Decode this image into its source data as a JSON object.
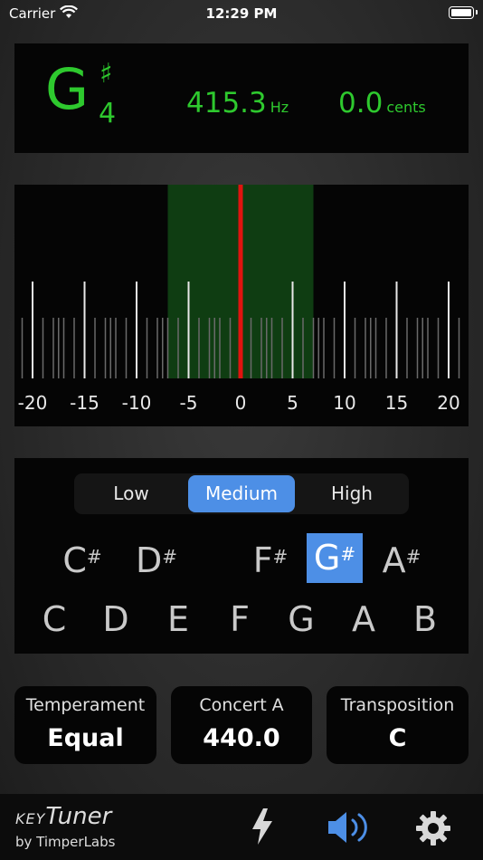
{
  "status_bar": {
    "carrier": "Carrier",
    "time": "12:29 PM"
  },
  "note": {
    "letter": "G",
    "accidental": "♯",
    "octave": "4",
    "frequency": "415.3",
    "frequency_unit": "Hz",
    "cents": "0.0",
    "cents_unit": "cents",
    "color": "#2ec92e"
  },
  "meter": {
    "ticks": [
      "-20",
      "-15",
      "-10",
      "-5",
      "0",
      "5",
      "10",
      "15",
      "20"
    ],
    "needle_cents": 0.0,
    "in_tune_band_color": "#0f3d12",
    "needle_color": "#e0130f"
  },
  "range_selector": {
    "options": [
      "Low",
      "Medium",
      "High"
    ],
    "selected": "Medium"
  },
  "keys": {
    "sharps": [
      {
        "letter": "C",
        "sym": "#"
      },
      {
        "letter": "D",
        "sym": "#"
      },
      {
        "letter": "F",
        "sym": "#"
      },
      {
        "letter": "G",
        "sym": "#"
      },
      {
        "letter": "A",
        "sym": "#"
      }
    ],
    "naturals": [
      "C",
      "D",
      "E",
      "F",
      "G",
      "A",
      "B"
    ],
    "selected": "G#",
    "accent": "#4d8fe6"
  },
  "settings": {
    "temperament": {
      "label": "Temperament",
      "value": "Equal"
    },
    "concert_a": {
      "label": "Concert A",
      "value": "440.0"
    },
    "transposition": {
      "label": "Transposition",
      "value": "C"
    }
  },
  "branding": {
    "key": "KEY",
    "tuner": "Tuner",
    "byline": "by TimperLabs"
  },
  "toolbar": {
    "icons": [
      "lightning-icon",
      "speaker-icon",
      "gear-icon"
    ]
  }
}
